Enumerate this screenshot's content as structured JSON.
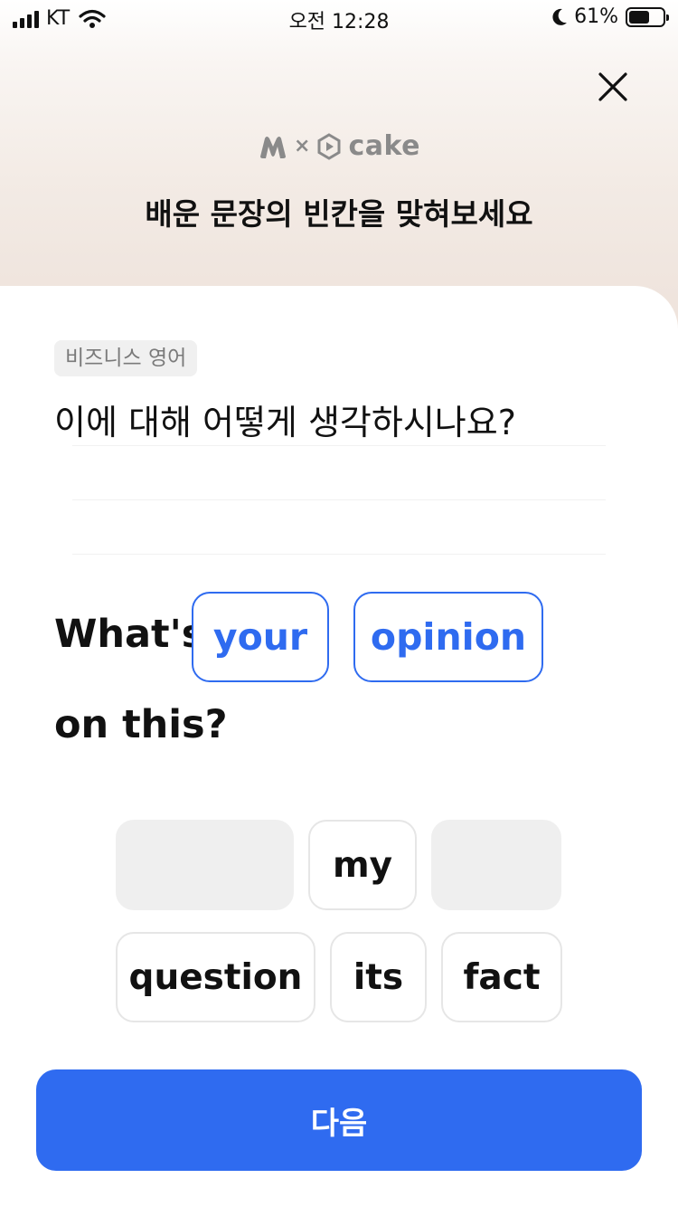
{
  "status_bar": {
    "carrier": "KT",
    "time": "오전 12:28",
    "battery_percent": "61%",
    "battery_level": 0.61,
    "icons": [
      "signal-icon",
      "wifi-icon",
      "moon-icon",
      "battery-icon"
    ]
  },
  "header": {
    "close_icon": "close-icon",
    "logo_separator": "×",
    "logo_brand": "cake",
    "title": "배운 문장의 빈칸을 맞혀보세요"
  },
  "quiz": {
    "category": "비즈니스 영어",
    "korean_sentence": "이에 대해 어떻게 생각하시나요?",
    "sentence_prefix": "What's",
    "filled_blanks": [
      "your",
      "opinion"
    ],
    "sentence_suffix": "on this?"
  },
  "word_bank": {
    "row1": [
      "",
      "my",
      ""
    ],
    "row2": [
      "question",
      "its",
      "fact"
    ]
  },
  "footer": {
    "next_label": "다음"
  },
  "colors": {
    "accent": "#2f6bf0",
    "header_bg": "#f3ebe5",
    "chip_border": "#e6e6e6",
    "empty_chip": "#efefef"
  }
}
